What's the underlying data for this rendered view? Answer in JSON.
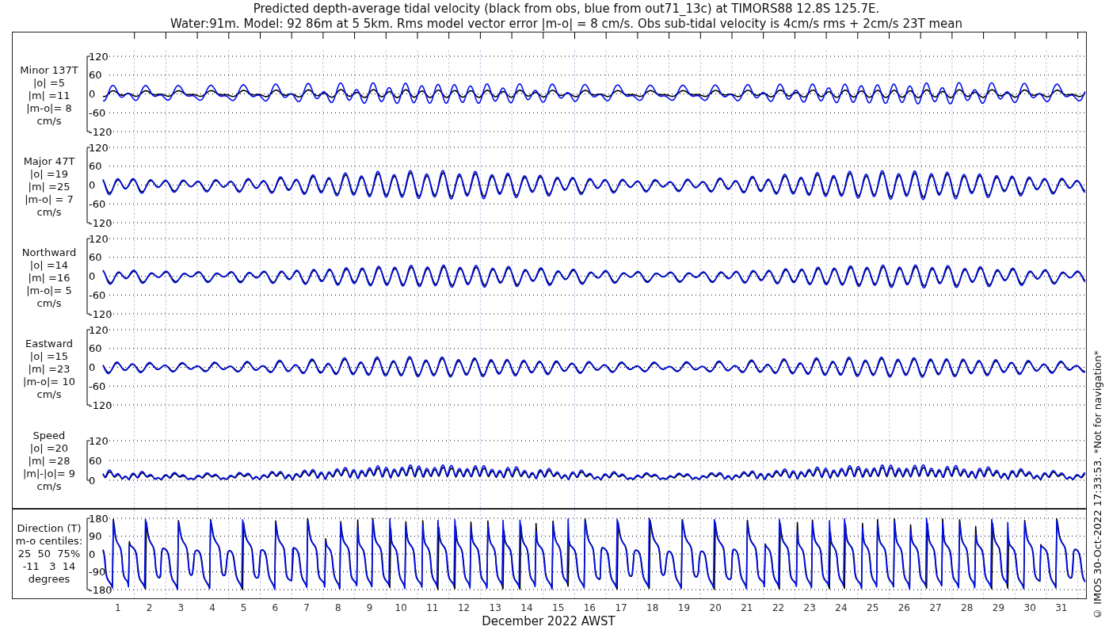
{
  "title_lines": [
    "Predicted depth-average tidal velocity (black from obs, blue from out71_13c) at TIMORS88 12.8S 125.7E.",
    "Water:91m. Model: 92 86m at 5 5km. Rms model vector error |m-o| = 8 cm/s. Obs sub-tidal velocity is 4cm/s rms + 2cm/s 23T mean"
  ],
  "panels": [
    {
      "kind": "minor",
      "label_lines": [
        "Minor 137T",
        "|o| =5",
        "|m| =11",
        "|m-o|= 8",
        "cm/s"
      ],
      "yticks": [
        "120",
        "60",
        "0",
        "-60",
        "-120"
      ]
    },
    {
      "kind": "major",
      "label_lines": [
        "Major 47T",
        "|o| =19",
        "|m| =25",
        "|m-o| = 7",
        "cm/s"
      ],
      "yticks": [
        "120",
        "60",
        "0",
        "-60",
        "-120"
      ]
    },
    {
      "kind": "north",
      "label_lines": [
        "Northward",
        "|o| =14",
        "|m| =16",
        "|m-o|= 5",
        "cm/s"
      ],
      "yticks": [
        "120",
        "60",
        "0",
        "-60",
        "-120"
      ]
    },
    {
      "kind": "east",
      "label_lines": [
        "Eastward",
        "|o| =15",
        "|m| =23",
        "|m-o|= 10",
        "cm/s"
      ],
      "yticks": [
        "120",
        "60",
        "0",
        "-60",
        "-120"
      ]
    },
    {
      "kind": "speed",
      "label_lines": [
        "Speed",
        "|o| =20",
        "|m| =28",
        "|m|-|o|= 9",
        "cm/s"
      ],
      "yticks": [
        "120",
        "60",
        "0"
      ]
    },
    {
      "kind": "direction",
      "label_lines": [
        "Direction (T)",
        "m-o centiles:",
        "25  50  75%",
        "-11   3  14",
        "degrees"
      ],
      "yticks": [
        "180",
        "90",
        "0",
        "-90",
        "-180"
      ]
    }
  ],
  "day_labels": [
    "1",
    "2",
    "3",
    "4",
    "5",
    "6",
    "7",
    "8",
    "9",
    "10",
    "11",
    "12",
    "13",
    "14",
    "15",
    "16",
    "17",
    "18",
    "19",
    "20",
    "21",
    "22",
    "23",
    "24",
    "25",
    "26",
    "27",
    "28",
    "29",
    "30",
    "31"
  ],
  "xlabel": "December 2022 AWST",
  "copyright": "© IMOS 30-Oct-2022 17:33:53. *Not for navigation*"
}
